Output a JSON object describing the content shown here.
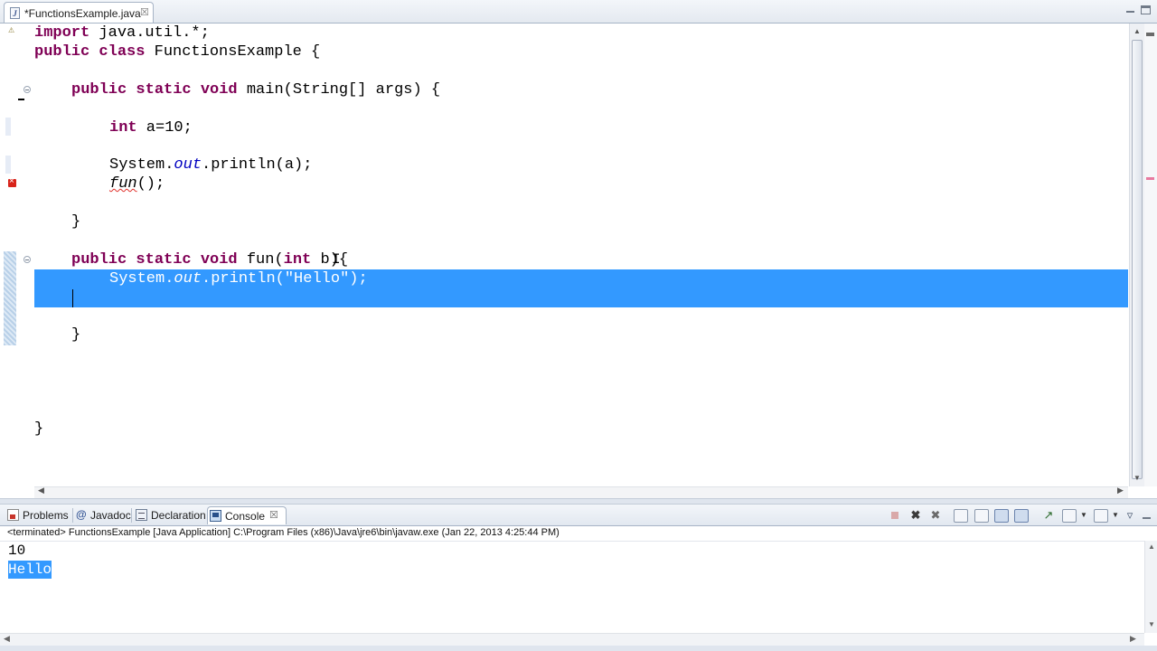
{
  "editor_tab": {
    "title": "*FunctionsExample.java",
    "close_glyph": "☒",
    "file_glyph": "J"
  },
  "code_lines": [
    {
      "kw": "import",
      "rest": " java.util.*;"
    },
    {
      "kw": "public class",
      "rest": " FunctionsExample {"
    },
    {
      "kw": "public static void",
      "rest": " main(String[] args) {"
    },
    {
      "kw": "int",
      "rest": " a=10;"
    },
    {
      "pre": "System.",
      "field": "out",
      "post": ".println(a);"
    },
    {
      "err": "fun",
      "post": "();"
    },
    {
      "text": "}"
    },
    {
      "kw": "public static void",
      "mid": " fun(",
      "kw2": "int",
      "post": " b){"
    },
    {
      "pre": "System.",
      "field": "out",
      "post": ".println(",
      "str": "\"Hello\"",
      "tail": ");"
    },
    {
      "text": "}"
    },
    {
      "text": "}"
    }
  ],
  "bottom_tabs": {
    "problems": "Problems",
    "javadoc": "Javadoc",
    "declaration": "Declaration",
    "console": "Console"
  },
  "console": {
    "header": "<terminated> FunctionsExample [Java Application] C:\\Program Files (x86)\\Java\\jre6\\bin\\javaw.exe (Jan 22, 2013 4:25:44 PM)",
    "output": [
      "10",
      "Hello"
    ]
  },
  "colors": {
    "keyword": "#7f0055",
    "field": "#0000c0",
    "string": "#2a00ff",
    "selection": "#3399ff"
  }
}
